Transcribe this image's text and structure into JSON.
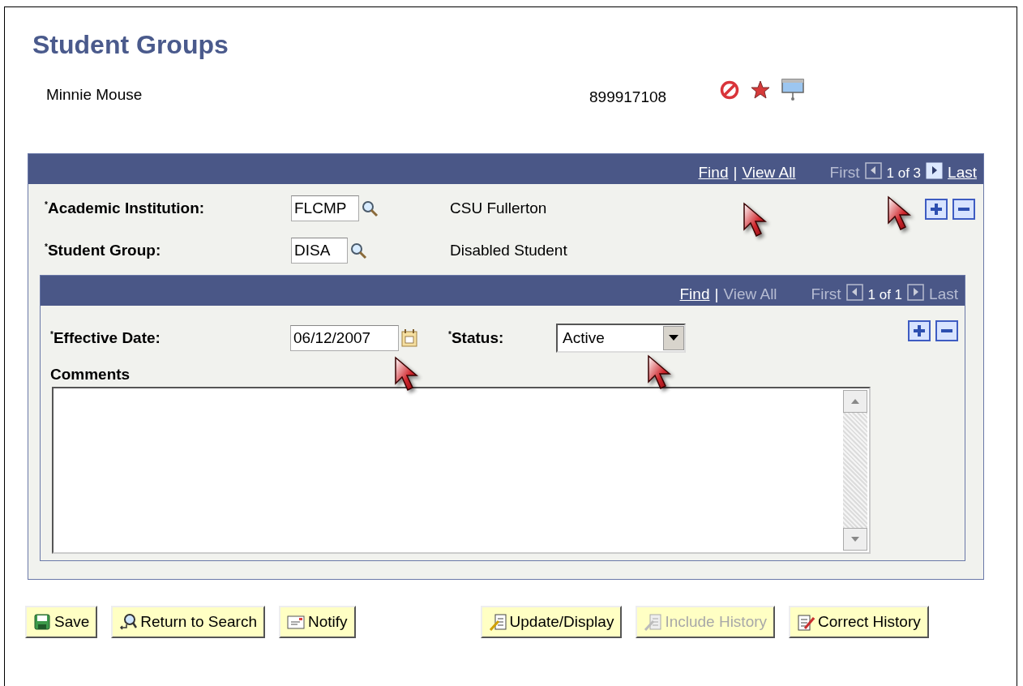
{
  "page": {
    "title": "Student Groups",
    "person_name": "Minnie Mouse",
    "person_id": "899917108"
  },
  "outer_grid": {
    "nav": {
      "find": {
        "label": "Find",
        "disabled": false
      },
      "separator": "|",
      "view_all": {
        "label": "View All",
        "disabled": false
      },
      "first": {
        "label": "First",
        "disabled": true
      },
      "previous_disabled": true,
      "counter": "1 of 3",
      "next_disabled": false,
      "last": {
        "label": "Last",
        "disabled": false
      }
    },
    "fields": [
      {
        "label": "$^{*}$Academic Institution:",
        "value": "FLCMP",
        "description": "CSU Fullerton"
      },
      {
        "label": "$^{*}$Student Group:",
        "value": "DISA",
        "description": "Disabled Student"
      }
    ]
  },
  "inner_grid": {
    "nav": {
      "find": {
        "label": "Find",
        "disabled": false
      },
      "separator": "|",
      "view_all": {
        "label": "View All",
        "disabled": true
      },
      "first": {
        "label": "First",
        "disabled": true
      },
      "previous_disabled": true,
      "counter": "1 of 1",
      "next_disabled": true,
      "last": {
        "label": "Last",
        "disabled": true
      }
    },
    "effective_date": {
      "label": "$^{*}$Effective Date:",
      "value": "06/12/2007"
    },
    "status": {
      "label": "$^{*}$Status:",
      "value": "Active"
    },
    "comments": {
      "label": "Comments"
    }
  },
  "buttons": [
    {
      "kind": "save",
      "label": "Save",
      "disabled": false
    },
    {
      "kind": "search",
      "label": "Return to Search",
      "disabled": false
    },
    {
      "kind": "notify",
      "label": "Notify",
      "disabled": false
    },
    {
      "kind": "update",
      "label": "Update/Display",
      "disabled": false
    },
    {
      "kind": "include",
      "label": "Include History",
      "disabled": true
    },
    {
      "kind": "correct",
      "label": "Correct History",
      "disabled": false
    }
  ]
}
